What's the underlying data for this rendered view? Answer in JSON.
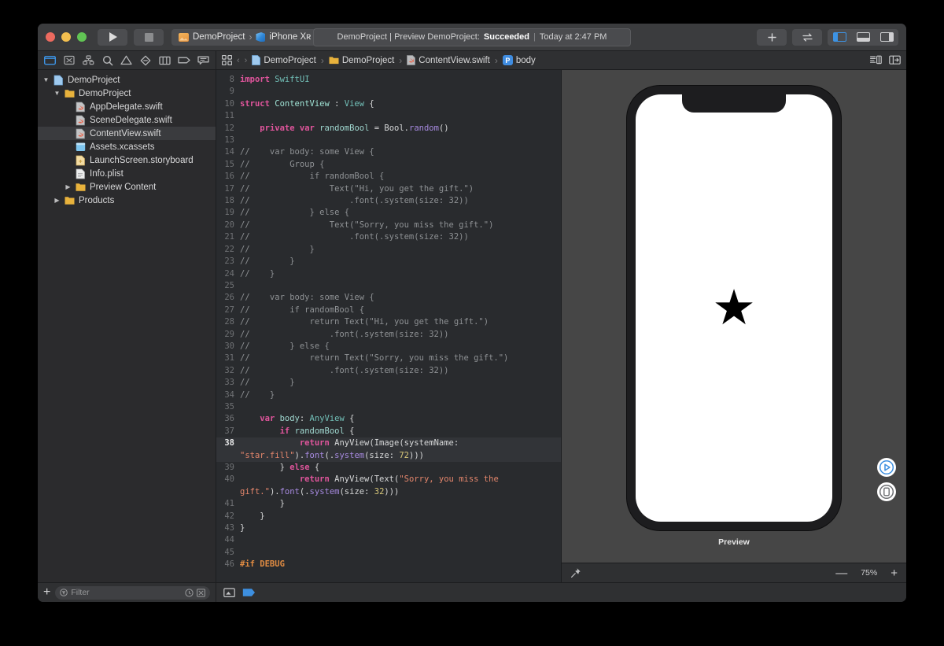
{
  "window": {
    "traffic_lights": [
      "close",
      "minimize",
      "zoom"
    ],
    "run_button": "run-icon",
    "stop_button": "stop-icon",
    "scheme": {
      "project": "DemoProject",
      "separator": "›",
      "destination": "iPhone Xʀ"
    },
    "status": {
      "prefix": "DemoProject | Preview DemoProject:",
      "result": "Succeeded",
      "divider": "|",
      "time": "Today at 2:47 PM"
    },
    "right_buttons": [
      "add-icon",
      "swap-icon"
    ],
    "pane_toggles": [
      "navigator-pane",
      "debug-pane",
      "inspector-pane"
    ]
  },
  "navigator": {
    "toolbar_icons": [
      "project-navigator-icon",
      "source-control-navigator-icon",
      "symbol-navigator-icon",
      "find-navigator-icon",
      "issue-navigator-icon",
      "test-navigator-icon",
      "debug-navigator-icon",
      "breakpoint-navigator-icon",
      "report-navigator-icon"
    ],
    "tree": [
      {
        "label": "DemoProject",
        "depth": 0,
        "icon": "project-icon",
        "twisty": "open",
        "selected": false
      },
      {
        "label": "DemoProject",
        "depth": 1,
        "icon": "folder-icon",
        "twisty": "open",
        "selected": false
      },
      {
        "label": "AppDelegate.swift",
        "depth": 2,
        "icon": "swift-file-icon",
        "twisty": "none",
        "selected": false
      },
      {
        "label": "SceneDelegate.swift",
        "depth": 2,
        "icon": "swift-file-icon",
        "twisty": "none",
        "selected": false
      },
      {
        "label": "ContentView.swift",
        "depth": 2,
        "icon": "swift-file-icon",
        "twisty": "none",
        "selected": true
      },
      {
        "label": "Assets.xcassets",
        "depth": 2,
        "icon": "assets-icon",
        "twisty": "none",
        "selected": false
      },
      {
        "label": "LaunchScreen.storyboard",
        "depth": 2,
        "icon": "storyboard-icon",
        "twisty": "none",
        "selected": false
      },
      {
        "label": "Info.plist",
        "depth": 2,
        "icon": "plist-icon",
        "twisty": "none",
        "selected": false
      },
      {
        "label": "Preview Content",
        "depth": 2,
        "icon": "folder-icon",
        "twisty": "closed",
        "selected": false
      },
      {
        "label": "Products",
        "depth": 1,
        "icon": "folder-icon",
        "twisty": "closed",
        "selected": false
      }
    ],
    "bottom": {
      "add_label": "+",
      "filter_placeholder": "Filter",
      "filter_value": "",
      "icons": [
        "recent-icon",
        "source-control-filter-icon"
      ]
    }
  },
  "editor": {
    "jumpbar": {
      "grid_icon": "related-items-icon",
      "back": "‹",
      "forward": "›",
      "crumbs": [
        {
          "label": "DemoProject",
          "icon": "project-icon"
        },
        {
          "label": "DemoProject",
          "icon": "folder-icon"
        },
        {
          "label": "ContentView.swift",
          "icon": "swift-file-icon"
        },
        {
          "label": "body",
          "icon": "property-badge",
          "badge": "P"
        }
      ],
      "right_icons": [
        "minimap-icon",
        "editor-options-icon"
      ]
    },
    "bottom_icons": [
      "show-debug-icon",
      "breakpoint-icon"
    ],
    "lines": [
      {
        "n": "8",
        "hl": false,
        "tokens": [
          {
            "t": "import",
            "c": "kw"
          },
          {
            "t": " ",
            "c": "pl"
          },
          {
            "t": "SwiftUI",
            "c": "type"
          }
        ]
      },
      {
        "n": "9",
        "hl": false,
        "tokens": []
      },
      {
        "n": "10",
        "hl": false,
        "tokens": [
          {
            "t": "struct",
            "c": "kw"
          },
          {
            "t": " ",
            "c": "pl"
          },
          {
            "t": "ContentView",
            "c": "typ2"
          },
          {
            "t": " : ",
            "c": "pl"
          },
          {
            "t": "View",
            "c": "type"
          },
          {
            "t": " {",
            "c": "pl"
          }
        ]
      },
      {
        "n": "11",
        "hl": false,
        "tokens": []
      },
      {
        "n": "12",
        "hl": false,
        "tokens": [
          {
            "t": "    ",
            "c": "pl"
          },
          {
            "t": "private",
            "c": "kw"
          },
          {
            "t": " ",
            "c": "pl"
          },
          {
            "t": "var",
            "c": "kw"
          },
          {
            "t": " ",
            "c": "pl"
          },
          {
            "t": "randomBool",
            "c": "prop"
          },
          {
            "t": " = ",
            "c": "pl"
          },
          {
            "t": "Bool",
            "c": "pl"
          },
          {
            "t": ".",
            "c": "pl"
          },
          {
            "t": "random",
            "c": "meth"
          },
          {
            "t": "()",
            "c": "pl"
          }
        ]
      },
      {
        "n": "13",
        "hl": false,
        "tokens": []
      },
      {
        "n": "14",
        "hl": false,
        "tokens": [
          {
            "t": "//    var body: some View {",
            "c": "cm"
          }
        ]
      },
      {
        "n": "15",
        "hl": false,
        "tokens": [
          {
            "t": "//        Group {",
            "c": "cm"
          }
        ]
      },
      {
        "n": "16",
        "hl": false,
        "tokens": [
          {
            "t": "//            if randomBool {",
            "c": "cm"
          }
        ]
      },
      {
        "n": "17",
        "hl": false,
        "tokens": [
          {
            "t": "//                Text(\"Hi, you get the gift.\")",
            "c": "cm"
          }
        ]
      },
      {
        "n": "18",
        "hl": false,
        "tokens": [
          {
            "t": "//                    .font(.system(size: 32))",
            "c": "cm"
          }
        ]
      },
      {
        "n": "19",
        "hl": false,
        "tokens": [
          {
            "t": "//            } else {",
            "c": "cm"
          }
        ]
      },
      {
        "n": "20",
        "hl": false,
        "tokens": [
          {
            "t": "//                Text(\"Sorry, you miss the gift.\")",
            "c": "cm"
          }
        ]
      },
      {
        "n": "21",
        "hl": false,
        "tokens": [
          {
            "t": "//                    .font(.system(size: 32))",
            "c": "cm"
          }
        ]
      },
      {
        "n": "22",
        "hl": false,
        "tokens": [
          {
            "t": "//            }",
            "c": "cm"
          }
        ]
      },
      {
        "n": "23",
        "hl": false,
        "tokens": [
          {
            "t": "//        }",
            "c": "cm"
          }
        ]
      },
      {
        "n": "24",
        "hl": false,
        "tokens": [
          {
            "t": "//    }",
            "c": "cm"
          }
        ]
      },
      {
        "n": "25",
        "hl": false,
        "tokens": []
      },
      {
        "n": "26",
        "hl": false,
        "tokens": [
          {
            "t": "//    var body: some View {",
            "c": "cm"
          }
        ]
      },
      {
        "n": "27",
        "hl": false,
        "tokens": [
          {
            "t": "//        if randomBool {",
            "c": "cm"
          }
        ]
      },
      {
        "n": "28",
        "hl": false,
        "tokens": [
          {
            "t": "//            return Text(\"Hi, you get the gift.\")",
            "c": "cm"
          }
        ]
      },
      {
        "n": "29",
        "hl": false,
        "tokens": [
          {
            "t": "//                .font(.system(size: 32))",
            "c": "cm"
          }
        ]
      },
      {
        "n": "30",
        "hl": false,
        "tokens": [
          {
            "t": "//        } else {",
            "c": "cm"
          }
        ]
      },
      {
        "n": "31",
        "hl": false,
        "tokens": [
          {
            "t": "//            return Text(\"Sorry, you miss the gift.\")",
            "c": "cm"
          }
        ]
      },
      {
        "n": "32",
        "hl": false,
        "tokens": [
          {
            "t": "//                .font(.system(size: 32))",
            "c": "cm"
          }
        ]
      },
      {
        "n": "33",
        "hl": false,
        "tokens": [
          {
            "t": "//        }",
            "c": "cm"
          }
        ]
      },
      {
        "n": "34",
        "hl": false,
        "tokens": [
          {
            "t": "//    }",
            "c": "cm"
          }
        ]
      },
      {
        "n": "35",
        "hl": false,
        "tokens": []
      },
      {
        "n": "36",
        "hl": false,
        "tokens": [
          {
            "t": "    ",
            "c": "pl"
          },
          {
            "t": "var",
            "c": "kw"
          },
          {
            "t": " ",
            "c": "pl"
          },
          {
            "t": "body",
            "c": "prop"
          },
          {
            "t": ": ",
            "c": "pl"
          },
          {
            "t": "AnyView",
            "c": "type"
          },
          {
            "t": " {",
            "c": "pl"
          }
        ]
      },
      {
        "n": "37",
        "hl": false,
        "tokens": [
          {
            "t": "        ",
            "c": "pl"
          },
          {
            "t": "if",
            "c": "kw"
          },
          {
            "t": " ",
            "c": "pl"
          },
          {
            "t": "randomBool",
            "c": "prop"
          },
          {
            "t": " {",
            "c": "pl"
          }
        ]
      },
      {
        "n": "38",
        "hl": true,
        "tokens": [
          {
            "t": "            ",
            "c": "pl"
          },
          {
            "t": "return",
            "c": "kw"
          },
          {
            "t": " ",
            "c": "pl"
          },
          {
            "t": "AnyView",
            "c": "pl"
          },
          {
            "t": "(",
            "c": "pl"
          },
          {
            "t": "Image",
            "c": "pl"
          },
          {
            "t": "(systemName: ",
            "c": "pl"
          },
          {
            "t": "\"star.fill\"",
            "c": "str"
          },
          {
            "t": ").",
            "c": "pl"
          },
          {
            "t": "font",
            "c": "meth"
          },
          {
            "t": "(.",
            "c": "pl"
          },
          {
            "t": "system",
            "c": "meth"
          },
          {
            "t": "(size: ",
            "c": "pl"
          },
          {
            "t": "72",
            "c": "num"
          },
          {
            "t": ")))",
            "c": "pl"
          }
        ]
      },
      {
        "n": "39",
        "hl": false,
        "tokens": [
          {
            "t": "        } ",
            "c": "pl"
          },
          {
            "t": "else",
            "c": "kw"
          },
          {
            "t": " {",
            "c": "pl"
          }
        ]
      },
      {
        "n": "40",
        "hl": false,
        "tokens": [
          {
            "t": "            ",
            "c": "pl"
          },
          {
            "t": "return",
            "c": "kw"
          },
          {
            "t": " ",
            "c": "pl"
          },
          {
            "t": "AnyView",
            "c": "pl"
          },
          {
            "t": "(",
            "c": "pl"
          },
          {
            "t": "Text",
            "c": "pl"
          },
          {
            "t": "(",
            "c": "pl"
          },
          {
            "t": "\"Sorry, you miss the gift.\"",
            "c": "str"
          },
          {
            "t": ").",
            "c": "pl"
          },
          {
            "t": "font",
            "c": "meth"
          },
          {
            "t": "(.",
            "c": "pl"
          },
          {
            "t": "system",
            "c": "meth"
          },
          {
            "t": "(size: ",
            "c": "pl"
          },
          {
            "t": "32",
            "c": "num"
          },
          {
            "t": ")))",
            "c": "pl"
          }
        ]
      },
      {
        "n": "41",
        "hl": false,
        "tokens": [
          {
            "t": "        }",
            "c": "pl"
          }
        ]
      },
      {
        "n": "42",
        "hl": false,
        "tokens": [
          {
            "t": "    }",
            "c": "pl"
          }
        ]
      },
      {
        "n": "43",
        "hl": false,
        "tokens": [
          {
            "t": "}",
            "c": "pl"
          }
        ]
      },
      {
        "n": "44",
        "hl": false,
        "tokens": []
      },
      {
        "n": "45",
        "hl": false,
        "tokens": []
      },
      {
        "n": "46",
        "hl": false,
        "tokens": [
          {
            "t": "#if DEBUG",
            "c": "pre"
          }
        ]
      }
    ]
  },
  "canvas": {
    "device_name": "iPhone Xr",
    "preview_content": {
      "symbol": "star.fill",
      "glyph": "★"
    },
    "preview_label": "Preview",
    "side_buttons": [
      "live-preview-play-icon",
      "preview-on-device-icon"
    ],
    "bottom": {
      "pin_icon": "pin-icon",
      "zoom_out": "—",
      "zoom_level": "75%",
      "zoom_in": "+"
    }
  },
  "colors": {
    "accent_blue": "#3d93e4",
    "editor_bg": "#292b2e",
    "canvas_bg": "#464646",
    "chrome_bg": "#2f3032",
    "titlebar_bg": "#3b3c3e",
    "selection": "#3a3b3e",
    "keyword": "#e0559c",
    "type": "#72c0b8",
    "string": "#e4866c",
    "number": "#d9c97a",
    "comment": "#8e9194",
    "method": "#a78ae0",
    "preprocessor": "#e08b42"
  }
}
